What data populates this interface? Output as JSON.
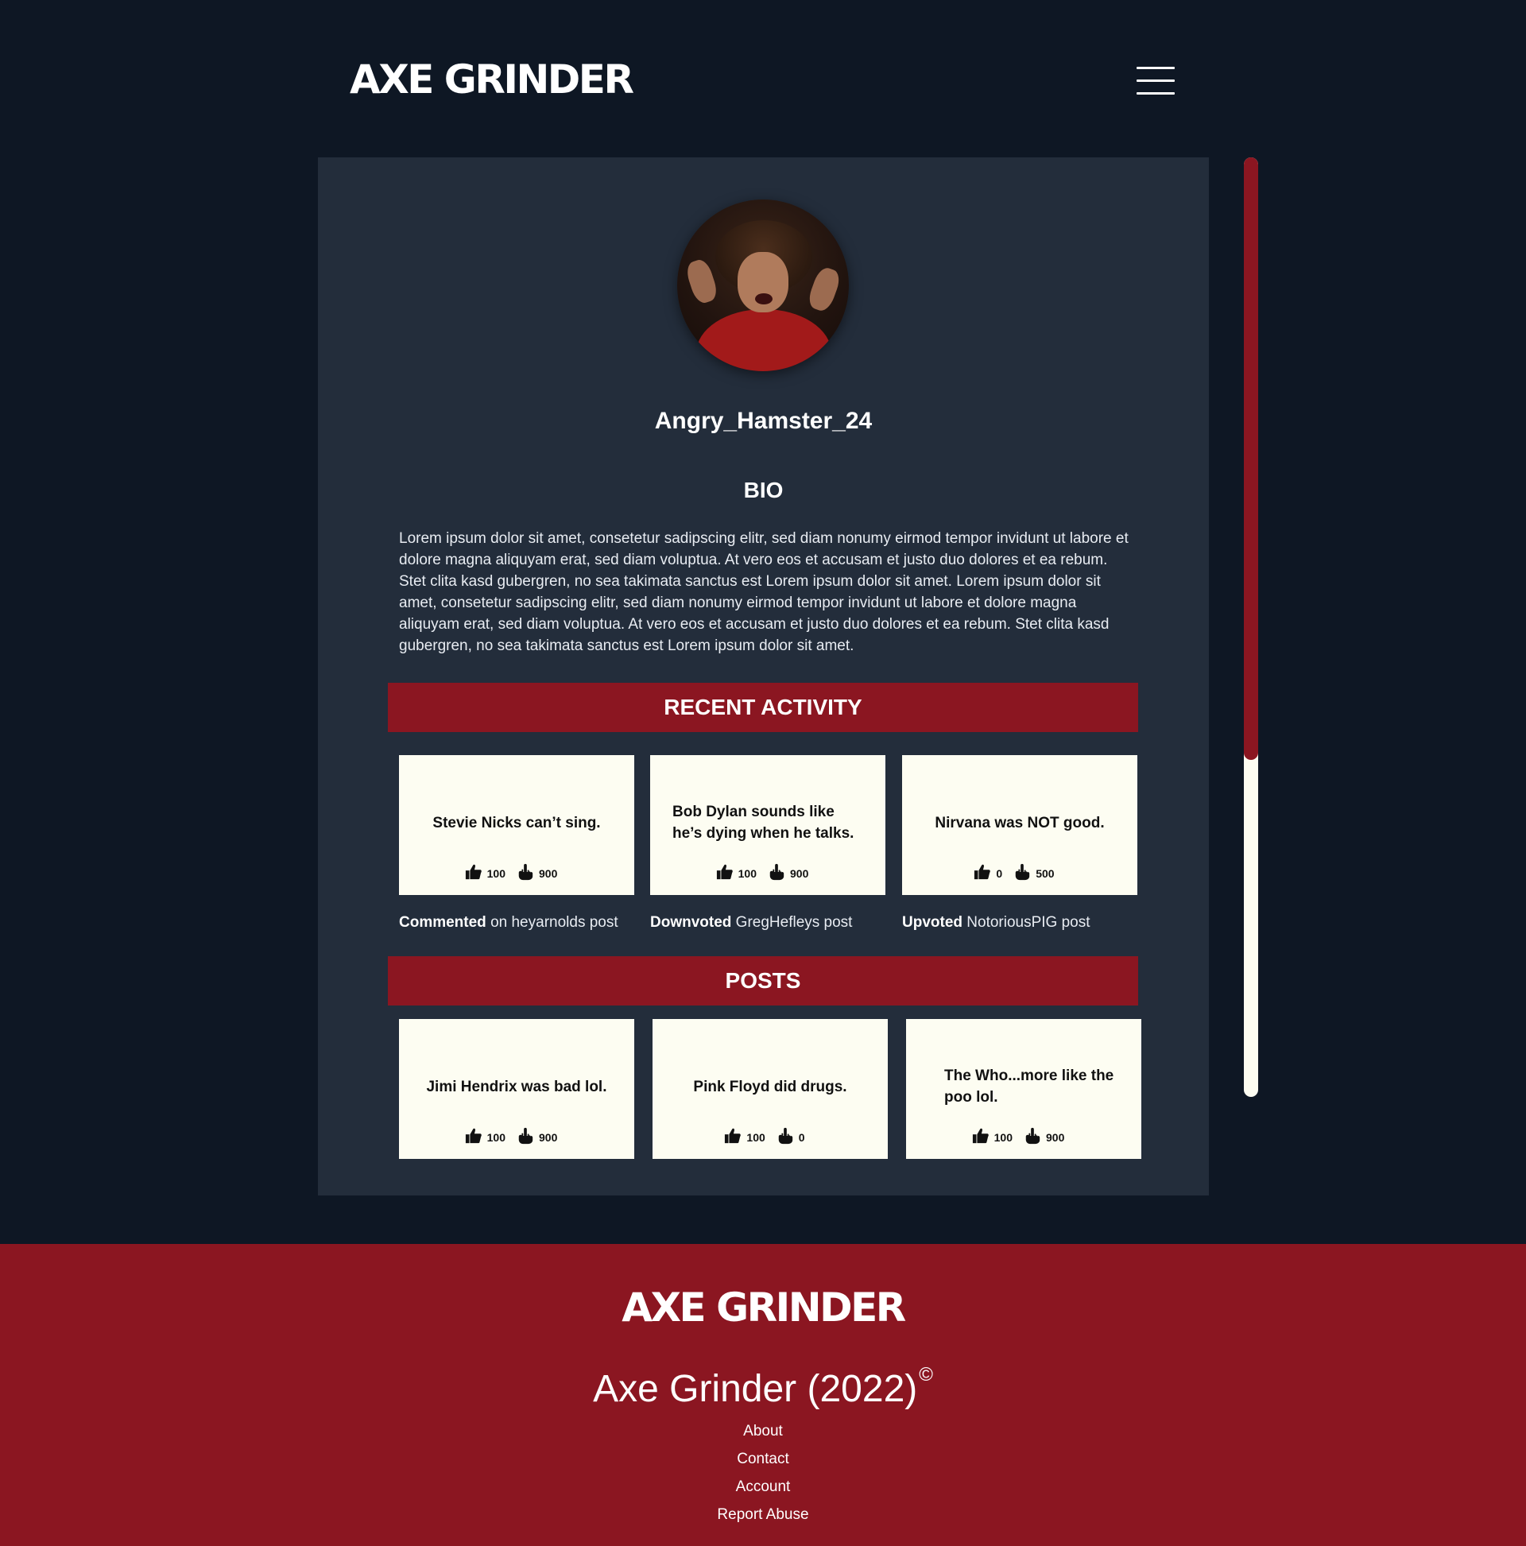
{
  "header": {
    "logo": "AXE GRINDER",
    "menu_icon": "hamburger-menu-icon"
  },
  "profile": {
    "username": "Angry_Hamster_24",
    "bio_heading": "BIO",
    "bio_text": "Lorem ipsum dolor sit amet, consetetur sadipscing elitr, sed diam nonumy eirmod tempor invidunt ut labore et dolore magna aliquyam erat, sed diam voluptua. At vero eos et accusam et justo duo dolores et ea rebum. Stet clita kasd gubergren, no sea takimata sanctus est Lorem ipsum dolor sit amet. Lorem ipsum dolor sit amet, consetetur sadipscing elitr, sed diam nonumy eirmod tempor invidunt ut labore et dolore magna aliquyam erat, sed diam voluptua. At vero eos et accusam et justo duo dolores et ea rebum. Stet clita kasd gubergren, no sea takimata sanctus est Lorem ipsum dolor sit amet."
  },
  "recent_activity": {
    "heading": "RECENT ACTIVITY",
    "items": [
      {
        "text": "Stevie Nicks can’t sing.",
        "upvotes": "100",
        "downvotes": "900",
        "action": "Commented",
        "detail": " on heyarnolds post"
      },
      {
        "text": "Bob Dylan sounds like he’s dying when he talks.",
        "upvotes": "100",
        "downvotes": "900",
        "action": "Downvoted",
        "detail": " GregHefleys post"
      },
      {
        "text": "Nirvana was NOT good.",
        "upvotes": "0",
        "downvotes": "500",
        "action": "Upvoted",
        "detail": " NotoriousPIG post"
      }
    ]
  },
  "posts": {
    "heading": "POSTS",
    "items": [
      {
        "text": "Jimi Hendrix was bad lol.",
        "upvotes": "100",
        "downvotes": "900"
      },
      {
        "text": "Pink Floyd did drugs.",
        "upvotes": "100",
        "downvotes": "0"
      },
      {
        "text": "The Who...more like the poo lol.",
        "upvotes": "100",
        "downvotes": "900"
      }
    ]
  },
  "icons": {
    "upvote": "thumbs-up-icon",
    "downvote": "middle-finger-icon"
  },
  "scroll": {
    "position_fraction": 0.64
  },
  "footer": {
    "logo": "AXE GRINDER",
    "copyright": "Axe Grinder (2022)",
    "copyright_symbol": "©",
    "links": [
      "About",
      "Contact",
      "Account",
      "Report Abuse"
    ]
  },
  "colors": {
    "background": "#0e1724",
    "card": "#232d3b",
    "accent": "#8b1621",
    "post_card": "#fdfdf2"
  }
}
